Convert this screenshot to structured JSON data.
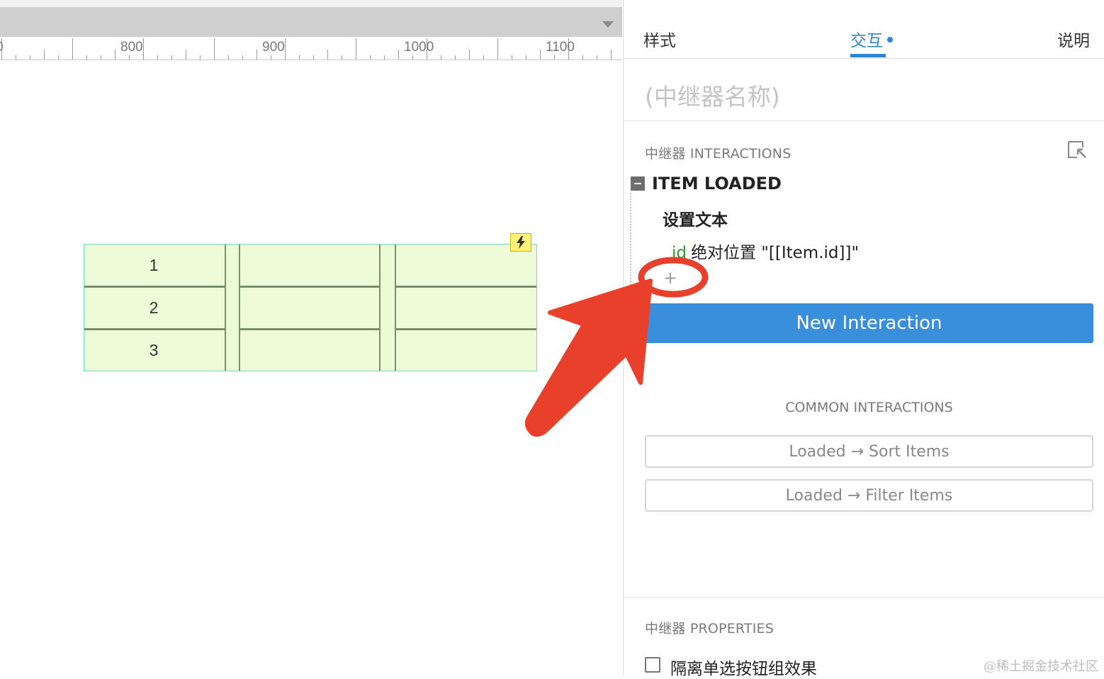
{
  "ruler": {
    "labels": [
      "800",
      "900",
      "1000",
      "1100"
    ]
  },
  "repeater": {
    "rows": [
      "1",
      "2",
      "3"
    ]
  },
  "colors": {
    "accent": "#3a8fdc",
    "annotation": "#e8402a",
    "repeater_fill": "#edfbd9",
    "repeater_border": "#6fd9c1"
  },
  "panel": {
    "tabs": {
      "style": "样式",
      "interactions": "交互",
      "notes": "说明"
    },
    "name_placeholder": "(中继器名称)",
    "interactions_title": "中继器 INTERACTIONS",
    "event": "ITEM LOADED",
    "action": "设置文本",
    "action_detail": {
      "key": "id",
      "value": "绝对位置 \"[[Item.id]]\""
    },
    "add_symbol": "+",
    "new_interaction_label": "New Interaction",
    "common_title": "COMMON INTERACTIONS",
    "common": [
      "Loaded → Sort Items",
      "Loaded → Filter Items"
    ],
    "properties_title": "中继器 PROPERTIES",
    "checkbox_label": "隔离单选按钮组效果"
  },
  "watermark": "@稀土掘金技术社区",
  "icons": {
    "collapse": "minus-square-icon",
    "lightning": "lightning-icon",
    "export": "export-arrow-icon",
    "dropdown": "chevron-down-icon"
  }
}
